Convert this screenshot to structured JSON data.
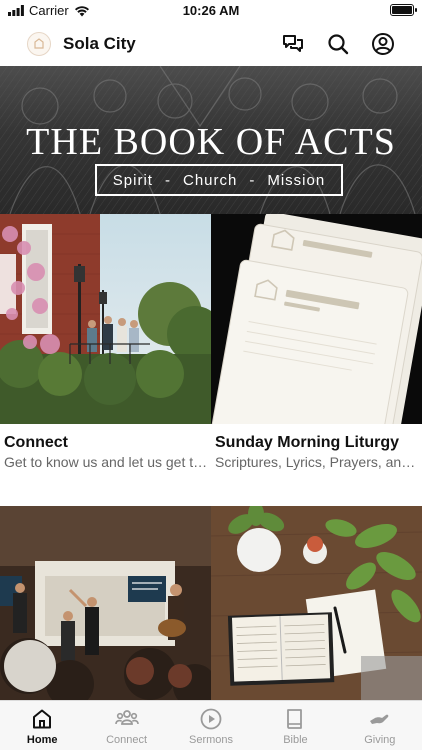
{
  "status_bar": {
    "carrier": "Carrier",
    "time": "10:26 AM"
  },
  "header": {
    "title": "Sola City"
  },
  "hero": {
    "title": "THE BOOK OF ACTS",
    "tagline": [
      "Spirit",
      "-",
      "Church",
      "-",
      "Mission"
    ]
  },
  "cards": [
    {
      "title": "Connect",
      "subtitle": "Get to know us and let us get to know you"
    },
    {
      "title": "Sunday Morning Liturgy",
      "subtitle": "Scriptures, Lyrics, Prayers, and more"
    }
  ],
  "tabs": [
    {
      "label": "Home",
      "icon": "home-icon",
      "active": true
    },
    {
      "label": "Connect",
      "icon": "people-icon",
      "active": false
    },
    {
      "label": "Sermons",
      "icon": "play-icon",
      "active": false
    },
    {
      "label": "Bible",
      "icon": "book-icon",
      "active": false
    },
    {
      "label": "Giving",
      "icon": "hand-icon",
      "active": false
    }
  ],
  "colors": {
    "active_tab": "#111111",
    "inactive_tab": "#9a9a9a",
    "hero_bg": "#4a4a4a"
  }
}
